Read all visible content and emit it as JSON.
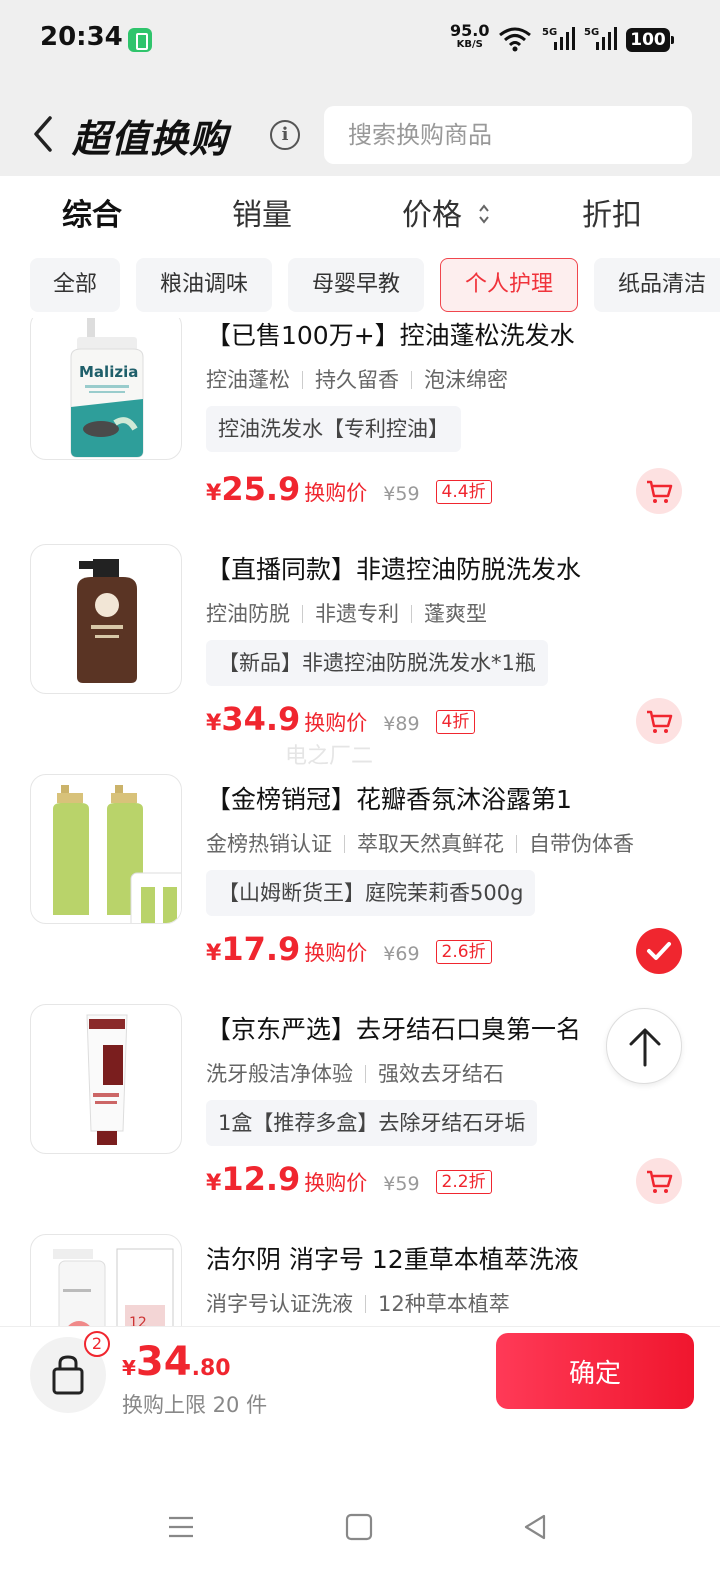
{
  "status": {
    "time": "20:34",
    "net_speed": "95.0",
    "net_unit": "KB/S",
    "signal1": "5G",
    "signal2": "5G",
    "battery": "100"
  },
  "header": {
    "title": "超值换购",
    "search_placeholder": "搜索换购商品"
  },
  "sort_tabs": [
    {
      "label": "综合",
      "active": true
    },
    {
      "label": "销量"
    },
    {
      "label": "价格"
    },
    {
      "label": "折扣"
    }
  ],
  "categories": [
    {
      "label": "全部"
    },
    {
      "label": "粮油调味"
    },
    {
      "label": "母婴早教"
    },
    {
      "label": "个人护理",
      "active": true
    },
    {
      "label": "纸品清洁"
    }
  ],
  "products": [
    {
      "title": "【已售100万+】控油蓬松洗发水",
      "features": [
        "控油蓬松",
        "持久留香",
        "泡沫绵密"
      ],
      "spec": "控油洗发水【专利控油】",
      "currency": "¥",
      "price": "25.9",
      "price_label": "换购价",
      "orig_price": "¥59",
      "discount": "4.4折",
      "selected": false,
      "image_brand": "Malizia"
    },
    {
      "title": "【直播同款】非遗控油防脱洗发水",
      "features": [
        "控油防脱",
        "非遗专利",
        "蓬爽型"
      ],
      "spec": "【新品】非遗控油防脱洗发水*1瓶",
      "currency": "¥",
      "price": "34.9",
      "price_label": "换购价",
      "orig_price": "¥89",
      "discount": "4折",
      "selected": false
    },
    {
      "title": "【金榜销冠】花瓣香氛沐浴露第1",
      "features": [
        "金榜热销认证",
        "萃取天然真鲜花",
        "自带伪体香"
      ],
      "spec": "【山姆断货王】庭院茉莉香500g",
      "currency": "¥",
      "price": "17.9",
      "price_label": "换购价",
      "orig_price": "¥69",
      "discount": "2.6折",
      "selected": true
    },
    {
      "title": "【京东严选】去牙结石口臭第一名",
      "features": [
        "洗牙般洁净体验",
        "强效去牙结石"
      ],
      "spec": "1盒【推荐多盒】去除牙结石牙垢",
      "currency": "¥",
      "price": "12.9",
      "price_label": "换购价",
      "orig_price": "¥59",
      "discount": "2.2折",
      "selected": false
    },
    {
      "title": "洁尔阴 消字号 12重草本植萃洗液",
      "features": [
        "消字号认证洗液",
        "12种草本植萃"
      ],
      "image_text": "12"
    }
  ],
  "watermark": "电之厂二",
  "footer": {
    "bag_count": "2",
    "currency": "¥",
    "total_int": "34",
    "total_dec": ".80",
    "limit_text": "换购上限 20 件",
    "confirm_label": "确定"
  },
  "colors": {
    "accent": "#f0262f",
    "chip_active_bg": "#fdeeee",
    "header_bg": "#efefef"
  },
  "icons": [
    "back-arrow-icon",
    "info-icon",
    "sort-arrows-icon",
    "cart-icon",
    "check-icon",
    "arrow-up-icon",
    "shopping-bag-icon",
    "menu-icon",
    "home-square-icon",
    "back-triangle-icon",
    "wifi-icon",
    "signal-icon",
    "battery-icon"
  ]
}
